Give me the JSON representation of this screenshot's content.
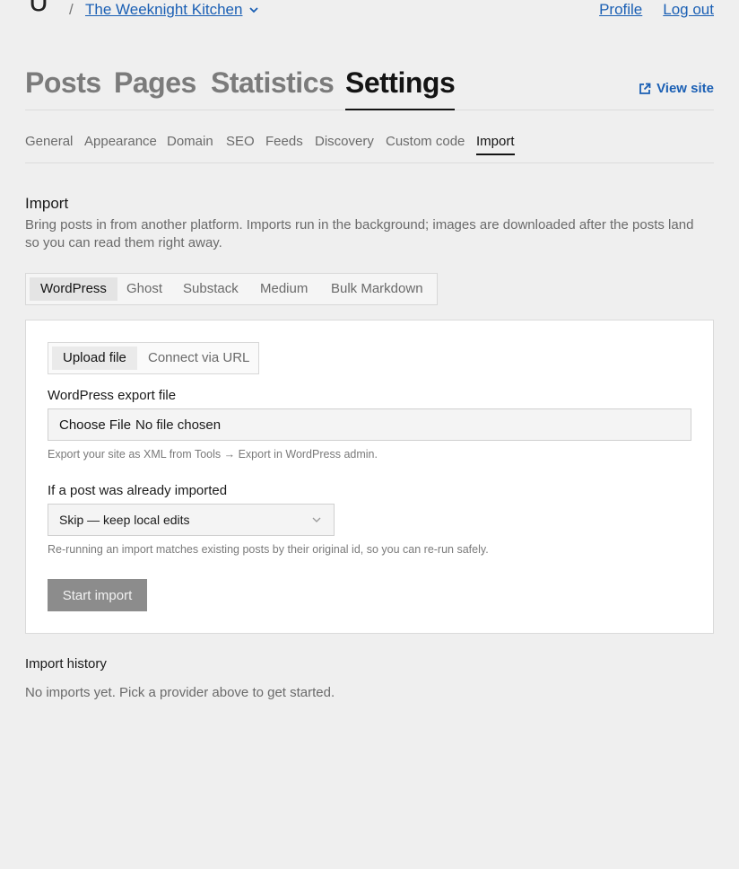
{
  "topbar": {
    "logo_glyph": "U",
    "separator": "/",
    "site_name": "The Weeknight Kitchen",
    "links": [
      "Profile",
      "Log out"
    ]
  },
  "main_tabs": {
    "items": [
      "Posts",
      "Pages",
      "Statistics",
      "Settings"
    ],
    "active": "Settings",
    "view_site": "View site"
  },
  "sub_tabs": {
    "items": [
      "General",
      "Appearance",
      "Domain",
      "SEO",
      "Feeds",
      "Discovery",
      "Custom code",
      "Import"
    ],
    "active": "Import"
  },
  "import": {
    "title": "Import",
    "description": "Bring posts in from another platform. Imports run in the background; images are downloaded after the posts land so you can read them right away.",
    "providers": [
      "WordPress",
      "Ghost",
      "Substack",
      "Medium",
      "Bulk Markdown"
    ],
    "active_provider": "WordPress",
    "methods": [
      "Upload file",
      "Connect via URL"
    ],
    "active_method": "Upload file",
    "file_label": "WordPress export file",
    "file_button": "Choose File",
    "file_status": "No file chosen",
    "file_help": "Export your site as XML from Tools → Export in WordPress admin.",
    "duplicate_label": "If a post was already imported",
    "duplicate_selected": "Skip — keep local edits",
    "duplicate_help": "Re-running an import matches existing posts by their original id, so you can re-run safely.",
    "start_button": "Start import"
  },
  "history": {
    "title": "Import history",
    "empty": "No imports yet. Pick a provider above to get started."
  },
  "colors": {
    "accent": "#1a5fb4",
    "background": "#efefef",
    "button_disabled": "#8c8c8c"
  }
}
